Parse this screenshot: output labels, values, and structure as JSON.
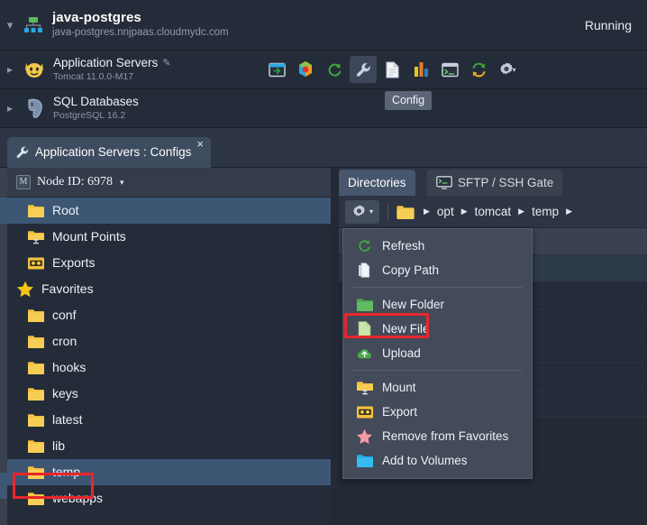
{
  "env": {
    "name": "java-postgres",
    "url": "java-postgres.nnjpaas.cloudmydc.com",
    "status": "Running",
    "collapse_icon": "chevron-down-icon",
    "env_icon": "environment-topology-icon"
  },
  "nodes": [
    {
      "title": "Application Servers",
      "subtitle": "Tomcat 11.0.0-M17",
      "icon": "tomcat-cat-icon",
      "expand_icon": "chevron-right-icon",
      "edit_icon": "pencil-icon"
    },
    {
      "title": "SQL Databases",
      "subtitle": "PostgreSQL 16.2",
      "icon": "postgresql-elephant-icon",
      "expand_icon": "chevron-right-icon"
    }
  ],
  "toolbar": {
    "buttons": [
      {
        "name": "open-in-browser-icon",
        "title": "Open in Browser"
      },
      {
        "name": "settings-colored-icon",
        "title": "Settings"
      },
      {
        "name": "restart-node-icon",
        "title": "Restart Node"
      },
      {
        "name": "config-wrench-icon",
        "title": "Config",
        "active": true
      },
      {
        "name": "log-file-icon",
        "title": "Log"
      },
      {
        "name": "statistics-bars-icon",
        "title": "Statistics"
      },
      {
        "name": "web-ssh-terminal-icon",
        "title": "Web SSH"
      },
      {
        "name": "redeploy-icon",
        "title": "Redeploy"
      },
      {
        "name": "additional-gear-icon",
        "title": "Additionally"
      }
    ],
    "tooltip": "Config"
  },
  "main_tab": {
    "icon": "config-wrench-icon",
    "label": "Application Servers : Configs",
    "close": "×"
  },
  "sidebar": {
    "node_id_label": "Node ID: 6978",
    "node_id_badge": "M",
    "node_id_caret": "▾",
    "items": [
      {
        "label": "Root",
        "icon": "folder-icon",
        "selected": true
      },
      {
        "label": "Mount Points",
        "icon": "folder-monitor-icon",
        "selected": false
      },
      {
        "label": "Exports",
        "icon": "folder-export-icon",
        "selected": false
      },
      {
        "label": "Favorites",
        "icon": "star-icon",
        "selected": false,
        "group": true
      },
      {
        "label": "conf",
        "icon": "folder-icon",
        "selected": false
      },
      {
        "label": "cron",
        "icon": "folder-icon",
        "selected": false
      },
      {
        "label": "hooks",
        "icon": "folder-icon",
        "selected": false
      },
      {
        "label": "keys",
        "icon": "folder-icon",
        "selected": false
      },
      {
        "label": "latest",
        "icon": "folder-icon",
        "selected": false
      },
      {
        "label": "lib",
        "icon": "folder-icon",
        "selected": false
      },
      {
        "label": "temp",
        "icon": "folder-icon",
        "selected": true,
        "highlighted": true
      },
      {
        "label": "webapps",
        "icon": "folder-icon",
        "selected": false
      }
    ]
  },
  "right_panel": {
    "tabs": [
      {
        "label": "Directories",
        "active": true,
        "icon": null
      },
      {
        "label": "SFTP / SSH Gate",
        "active": false,
        "icon": "monitor-terminal-icon"
      }
    ],
    "breadcrumb": {
      "gear_icon": "gear-icon",
      "gear_caret": "▾",
      "root_icon": "folder-icon",
      "separator": "▶",
      "path": [
        "opt",
        "tomcat",
        "temp"
      ]
    }
  },
  "context_menu": {
    "items": [
      {
        "label": "Refresh",
        "icon": "refresh-icon"
      },
      {
        "label": "Copy Path",
        "icon": "copy-path-icon"
      },
      {
        "separator": true
      },
      {
        "label": "New Folder",
        "icon": "new-folder-icon"
      },
      {
        "label": "New File",
        "icon": "new-file-icon",
        "highlighted": true
      },
      {
        "label": "Upload",
        "icon": "upload-cloud-icon"
      },
      {
        "separator": true
      },
      {
        "label": "Mount",
        "icon": "mount-folder-icon"
      },
      {
        "label": "Export",
        "icon": "export-folder-icon"
      },
      {
        "label": "Remove from Favorites",
        "icon": "star-pink-icon"
      },
      {
        "label": "Add to Volumes",
        "icon": "blue-folder-icon"
      }
    ]
  },
  "annotations": {
    "color": "#e8262b",
    "boxes": [
      "new-file-menu-item",
      "temp-tree-item"
    ]
  }
}
